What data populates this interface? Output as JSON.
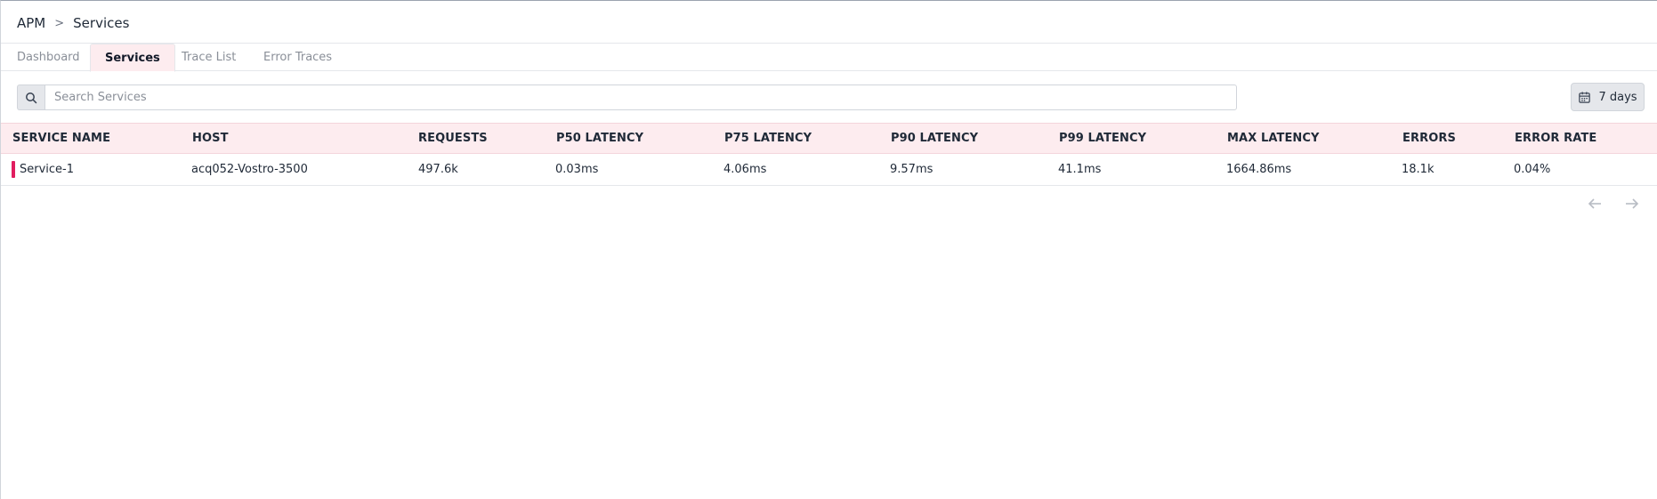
{
  "breadcrumb": {
    "root": "APM",
    "separator": ">",
    "current": "Services"
  },
  "tabs": [
    {
      "label": "Dashboard",
      "active": false
    },
    {
      "label": "Services",
      "active": true
    },
    {
      "label": "Trace List",
      "active": false
    },
    {
      "label": "Error Traces",
      "active": false
    }
  ],
  "search": {
    "placeholder": "Search Services",
    "value": "",
    "icon": "search-icon"
  },
  "date_range": {
    "label": "7 days",
    "icon": "calendar-icon"
  },
  "table": {
    "headers": [
      "SERVICE NAME",
      "HOST",
      "REQUESTS",
      "P50 LATENCY",
      "P75 LATENCY",
      "P90 LATENCY",
      "P99 LATENCY",
      "MAX LATENCY",
      "ERRORS",
      "ERROR RATE"
    ],
    "rows": [
      {
        "service_name": "Service-1",
        "host": "acq052-Vostro-3500",
        "requests": "497.6k",
        "p50": "0.03ms",
        "p75": "4.06ms",
        "p90": "9.57ms",
        "p99": "41.1ms",
        "max": "1664.86ms",
        "errors": "18.1k",
        "error_rate": "0.04%",
        "marker_color": "#e11d5f"
      }
    ]
  },
  "pagination": {
    "prev_icon": "arrow-left-icon",
    "next_icon": "arrow-right-icon"
  },
  "colors": {
    "accent": "#e11d5f",
    "header_bg": "#fdecef"
  }
}
